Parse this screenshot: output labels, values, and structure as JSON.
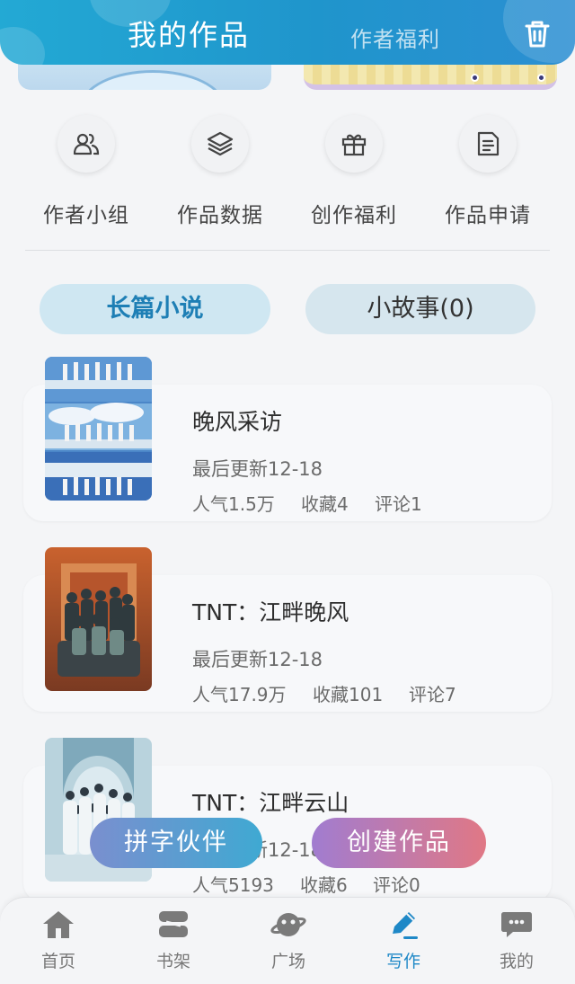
{
  "header": {
    "title": "我的作品",
    "tab2": "作者福利",
    "trash_icon": "trash-icon",
    "color": "#23a9d4"
  },
  "menu": {
    "items": [
      {
        "label": "作者小组",
        "icon": "users-icon"
      },
      {
        "label": "作品数据",
        "icon": "layers-icon"
      },
      {
        "label": "创作福利",
        "icon": "gift-icon"
      },
      {
        "label": "作品申请",
        "icon": "document-icon"
      }
    ]
  },
  "segments": {
    "novel": "长篇小说",
    "story": "小故事(0)"
  },
  "works": [
    {
      "title": "晚风采访",
      "updated": "最后更新12-18",
      "popularity": "人气1.5万",
      "favorites": "收藏4",
      "comments": "评论1"
    },
    {
      "title": "TNT：江畔晚风",
      "updated": "最后更新12-18",
      "popularity": "人气17.9万",
      "favorites": "收藏101",
      "comments": "评论7"
    },
    {
      "title": "TNT：江畔云山",
      "updated": "最后更新12-18",
      "popularity": "人气5193",
      "favorites": "收藏6",
      "comments": "评论0"
    }
  ],
  "actions": {
    "partner": "拼字伙伴",
    "create": "创建作品"
  },
  "nav": {
    "items": [
      {
        "label": "首页",
        "icon": "home-icon"
      },
      {
        "label": "书架",
        "icon": "bookshelf-icon"
      },
      {
        "label": "广场",
        "icon": "planet-icon"
      },
      {
        "label": "写作",
        "icon": "pen-icon",
        "active": true
      },
      {
        "label": "我的",
        "icon": "chat-icon"
      }
    ],
    "active_color": "#1e88c7"
  }
}
